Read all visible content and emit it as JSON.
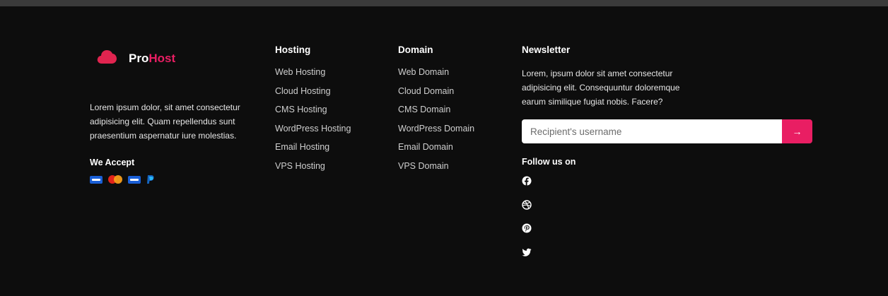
{
  "brand": {
    "name_prefix": "Pro",
    "name_accent": "Host",
    "accent_color": "#e91e63",
    "logo_icon": "cloud-icon"
  },
  "about": {
    "text": "Lorem ipsum dolor, sit amet consectetur adipisicing elit. Quam repellendus sunt praesentium aspernatur iure molestias."
  },
  "payments": {
    "title": "We Accept",
    "icons": [
      "visa-icon",
      "mastercard-icon",
      "amex-icon",
      "paypal-icon"
    ]
  },
  "hosting": {
    "title": "Hosting",
    "links": [
      "Web Hosting",
      "Cloud Hosting",
      "CMS Hosting",
      "WordPress Hosting",
      "Email Hosting",
      "VPS Hosting"
    ]
  },
  "domain": {
    "title": "Domain",
    "links": [
      "Web Domain",
      "Cloud Domain",
      "CMS Domain",
      "WordPress Domain",
      "Email Domain",
      "VPS Domain"
    ]
  },
  "newsletter": {
    "title": "Newsletter",
    "description": "Lorem, ipsum dolor sit amet consectetur adipisicing elit. Consequuntur doloremque earum similique fugiat nobis. Facere?",
    "input_placeholder": "Recipient's username",
    "input_value": "",
    "submit_icon": "arrow-right-icon",
    "submit_glyph": "→"
  },
  "follow": {
    "title": "Follow us on",
    "icons": [
      "facebook-icon",
      "dribbble-icon",
      "pinterest-icon",
      "twitter-icon"
    ]
  }
}
